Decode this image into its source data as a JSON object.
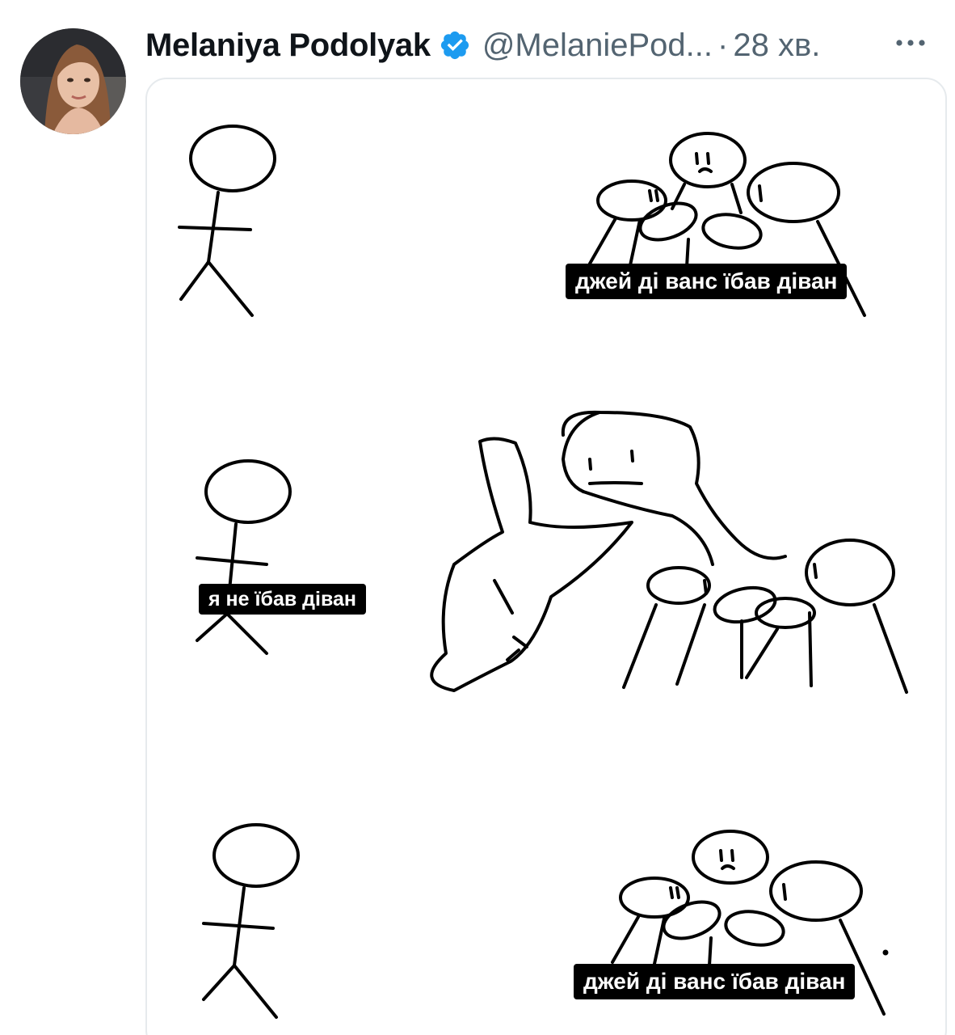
{
  "tweet": {
    "author_name": "Melaniya Podolyak",
    "author_handle": "@MelaniePod...",
    "separator": "·",
    "timestamp": "28 хв.",
    "verified": true
  },
  "icons": {
    "avatar": "profile-photo",
    "verified": "verified-badge-icon",
    "more": "more-options-icon"
  },
  "colors": {
    "verified_blue": "#1d9bf0",
    "name_text": "#0f1419",
    "secondary_text": "#536471",
    "caption_bg": "#000000",
    "caption_text": "#ffffff"
  },
  "meme": {
    "panel1_caption": "джей ді ванс їбав діван",
    "panel2_caption": "я не їбав діван",
    "panel3_caption": "джей ді ванс їбав діван"
  }
}
